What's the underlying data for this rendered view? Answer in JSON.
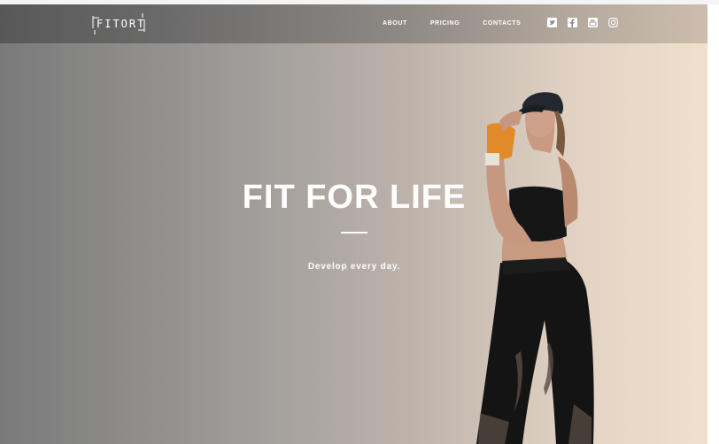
{
  "brand": {
    "logo_text": "FITORT"
  },
  "nav": {
    "items": [
      {
        "label": "ABOUT"
      },
      {
        "label": "PRICING"
      },
      {
        "label": "CONTACTS"
      }
    ]
  },
  "social": {
    "icons": [
      "twitter-icon",
      "facebook-icon",
      "youtube-icon",
      "instagram-icon"
    ]
  },
  "hero": {
    "headline": "FIT FOR LIFE",
    "tagline": "Develop every day."
  },
  "colors": {
    "gradient_start": "#7a7a7a",
    "gradient_end": "#f1dfcd",
    "text": "#ffffff"
  }
}
